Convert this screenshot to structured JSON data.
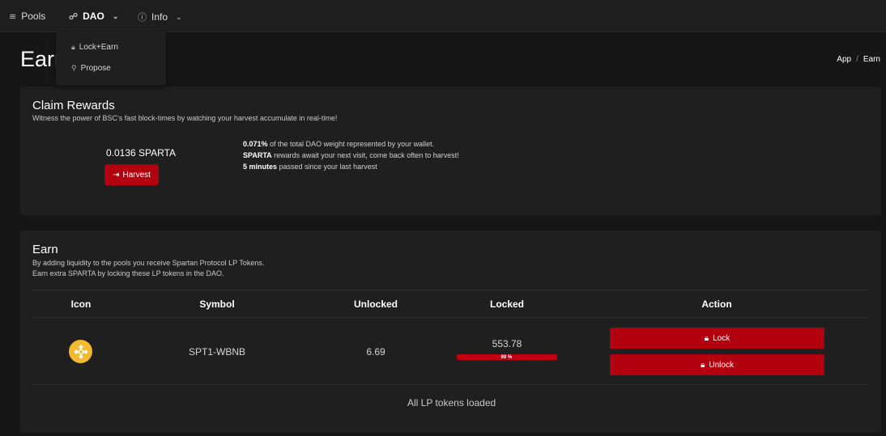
{
  "nav": {
    "pools": {
      "label": "Pools",
      "icon": "pools-icon"
    },
    "dao": {
      "label": "DAO",
      "icon": "dao-icon"
    },
    "info": {
      "label": "Info",
      "icon": "info-icon"
    }
  },
  "dropdown": {
    "items": [
      {
        "label": "Lock+Earn",
        "icon": "lock-icon"
      },
      {
        "label": "Propose",
        "icon": "pin-icon"
      }
    ]
  },
  "page": {
    "title": "Earn",
    "breadcrumb": [
      "App",
      "/",
      "Earn"
    ]
  },
  "claim": {
    "title": "Claim Rewards",
    "subtitle": "Witness the power of BSC's fast block-times by watching your harvest accumulate in real-time!",
    "amount": "0.0136 SPARTA",
    "harvest_label": "Harvest",
    "weight_bold": "0.071%",
    "weight_text": " of the total DAO weight represented by your wallet.",
    "rewards_bold": "SPARTA",
    "rewards_text": " rewards await your next visit, come back often to harvest!",
    "time_bold": "5 minutes",
    "time_text": " passed since your last harvest"
  },
  "earn": {
    "title": "Earn",
    "subtitle_1": "By adding liquidity to the pools you receive Spartan Protocol LP Tokens.",
    "subtitle_2": "Earn extra SPARTA by locking these LP tokens in the DAO.",
    "columns": [
      "Icon",
      "Symbol",
      "Unlocked",
      "Locked",
      "Action"
    ],
    "rows": [
      {
        "icon": "bnb-icon",
        "symbol": "SPT1-WBNB",
        "unlocked": "6.69",
        "locked": "553.78",
        "locked_pct": 99,
        "locked_pct_label": "99 %",
        "lock_label": "Lock",
        "unlock_label": "Unlock"
      }
    ],
    "footer": "All LP tokens loaded"
  },
  "colors": {
    "accent": "#b3000f",
    "background": "#161616",
    "card": "#1f1f1f",
    "bnb": "#f3ba2f"
  }
}
